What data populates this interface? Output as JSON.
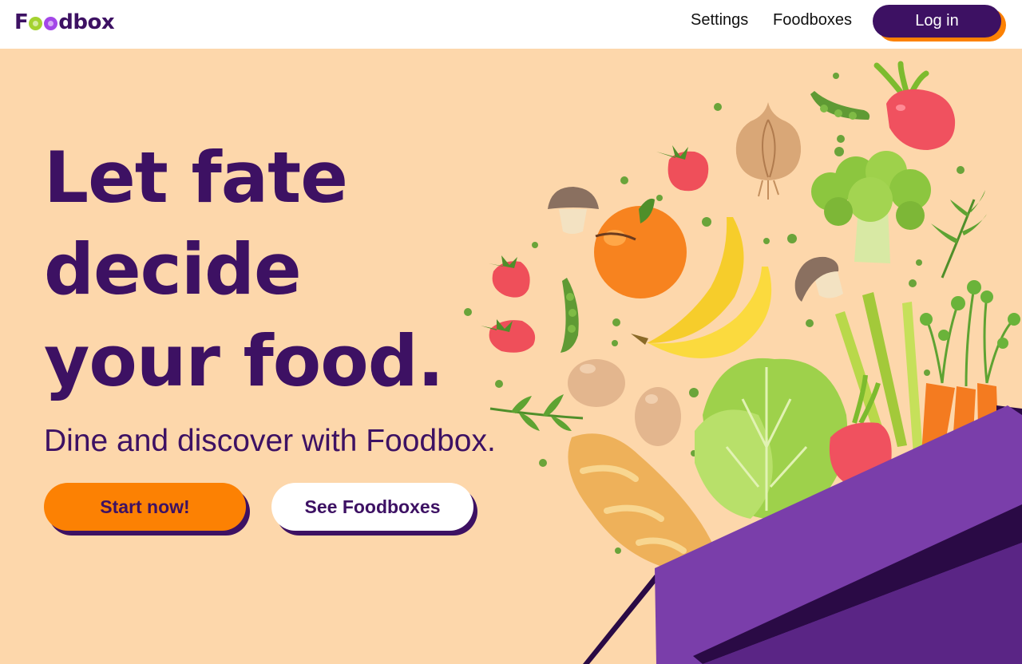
{
  "header": {
    "logo": {
      "text_start": "F",
      "text_end": "dbox",
      "o_colors": [
        "#a4d230",
        "#a347e8"
      ],
      "x_color_end": "#fc9e4f",
      "accessible_name": "Foodbox"
    },
    "nav": [
      {
        "label": "Settings"
      },
      {
        "label": "Foodboxes"
      }
    ],
    "login_label": "Log in"
  },
  "hero": {
    "title_lines": [
      "Let fate",
      "decide",
      "your food."
    ],
    "subtitle": "Dine and discover with Foodbox.",
    "primary_button": "Start now!",
    "secondary_button": "See Foodboxes"
  },
  "illustration": {
    "icons": [
      "box-icon",
      "banana-icon",
      "orange-icon",
      "broccoli-icon",
      "onion-icon",
      "mushroom-icon",
      "strawberry-icon",
      "lettuce-icon",
      "carrot-icon",
      "bread-icon",
      "egg-icon",
      "pea-pod-icon",
      "radish-icon",
      "leek-icon",
      "herb-icon"
    ]
  },
  "colors": {
    "brand_purple": "#3d1163",
    "accent_orange": "#fc8103",
    "hero_bg": "#fdd7ab",
    "box_purple": "#7a3eaa"
  }
}
